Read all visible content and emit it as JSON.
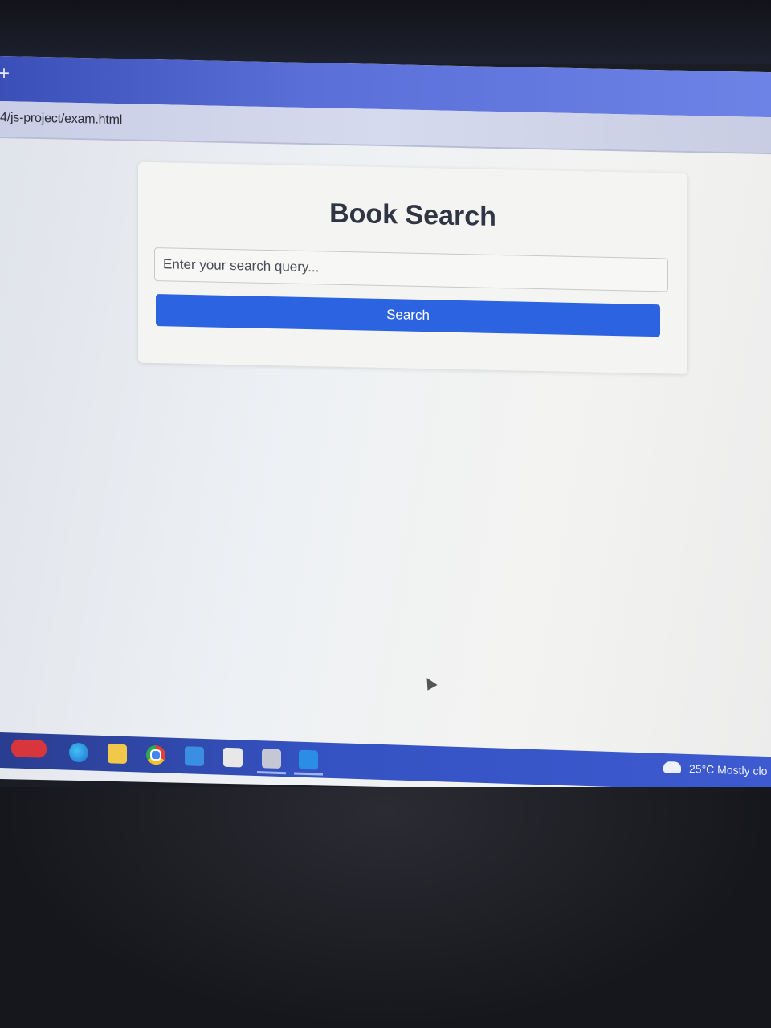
{
  "browser": {
    "new_tab_glyph": "+",
    "url": "4/js-project/exam.html"
  },
  "page": {
    "title": "Book Search",
    "search": {
      "placeholder": "Enter your search query...",
      "value": ""
    },
    "search_button_label": "Search",
    "accent_color": "#2b63e0"
  },
  "taskbar": {
    "icons": [
      "start-icon",
      "edge-icon",
      "folder-icon",
      "chrome-icon",
      "mail-icon",
      "store-icon",
      "app-icon",
      "vscode-icon"
    ],
    "weather": "25°C  Mostly clo"
  }
}
